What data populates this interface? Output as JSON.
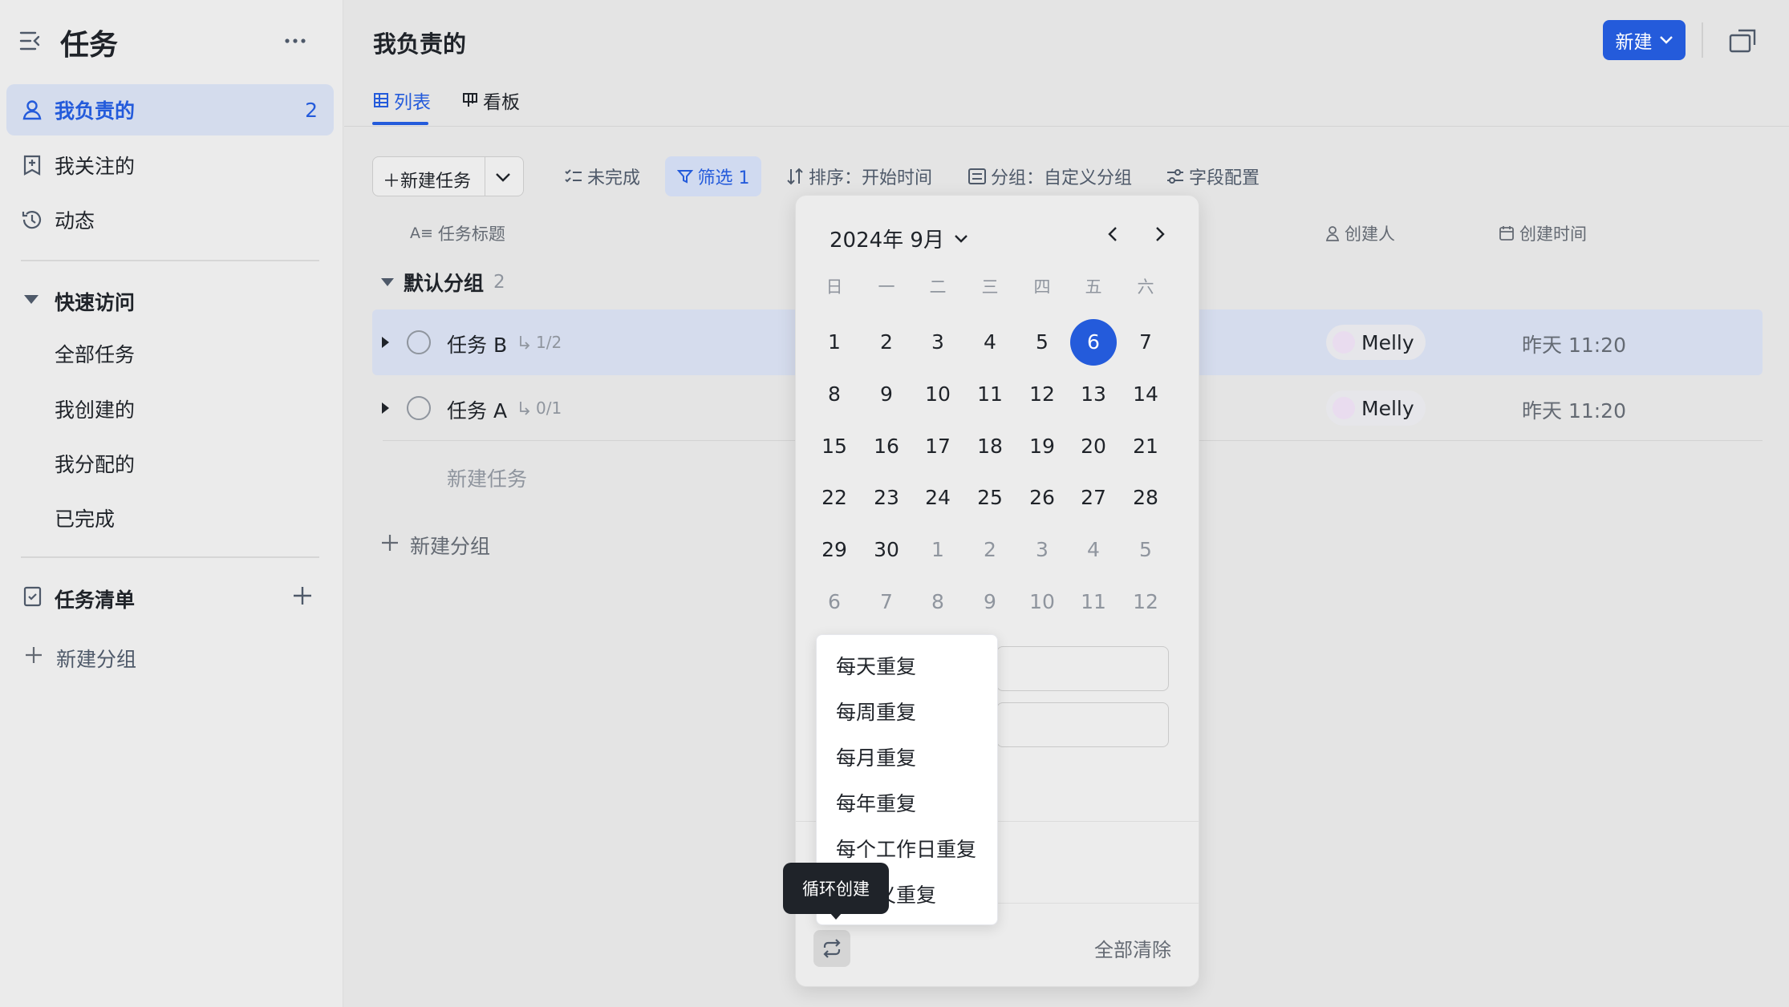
{
  "app": {
    "title": "任务"
  },
  "sidebar": {
    "items": [
      {
        "label": "我负责的",
        "count": "2"
      },
      {
        "label": "我关注的"
      },
      {
        "label": "动态"
      }
    ],
    "quick_access": {
      "label": "快速访问",
      "items": [
        "全部任务",
        "我创建的",
        "我分配的",
        "已完成"
      ]
    },
    "task_list": {
      "label": "任务清单"
    },
    "new_group": "新建分组"
  },
  "header": {
    "title": "我负责的",
    "new_button": "新建",
    "tabs": [
      "列表",
      "看板"
    ]
  },
  "toolbar": {
    "new_task": "新建任务",
    "incomplete": "未完成",
    "filter": "筛选 1",
    "sort": "排序：开始时间",
    "group": "分组：自定义分组",
    "fields": "字段配置"
  },
  "table": {
    "columns": {
      "title": "任务标题",
      "creator": "创建人",
      "created_at": "创建时间"
    },
    "group": {
      "name": "默认分组",
      "count": "2"
    },
    "rows": [
      {
        "title": "任务 B",
        "subtasks": "1/2",
        "creator": "Melly",
        "created": "昨天 11:20"
      },
      {
        "title": "任务 A",
        "subtasks": "0/1",
        "creator": "Melly",
        "created": "昨天 11:20"
      }
    ],
    "new_task_placeholder": "新建任务",
    "new_group": "新建分组"
  },
  "calendar": {
    "month_label": "2024年 9月",
    "weekdays": [
      "日",
      "一",
      "二",
      "三",
      "四",
      "五",
      "六"
    ],
    "today": "6",
    "weeks": [
      [
        "1",
        "2",
        "3",
        "4",
        "5",
        "6",
        "7"
      ],
      [
        "8",
        "9",
        "10",
        "11",
        "12",
        "13",
        "14"
      ],
      [
        "15",
        "16",
        "17",
        "18",
        "19",
        "20",
        "21"
      ],
      [
        "22",
        "23",
        "24",
        "25",
        "26",
        "27",
        "28"
      ],
      [
        "29",
        "30",
        "1",
        "2",
        "3",
        "4",
        "5"
      ],
      [
        "6",
        "7",
        "8",
        "9",
        "10",
        "11",
        "12"
      ]
    ],
    "clear_all": "全部清除"
  },
  "repeat_menu": {
    "items": [
      "每天重复",
      "每周重复",
      "每月重复",
      "每年重复",
      "每个工作日重复",
      "自定义重复"
    ]
  },
  "tooltip": {
    "text": "循环创建"
  },
  "colors": {
    "accent": "#245bdb",
    "sidebar_active": "#d4dced",
    "selected_row": "#d5dced"
  }
}
